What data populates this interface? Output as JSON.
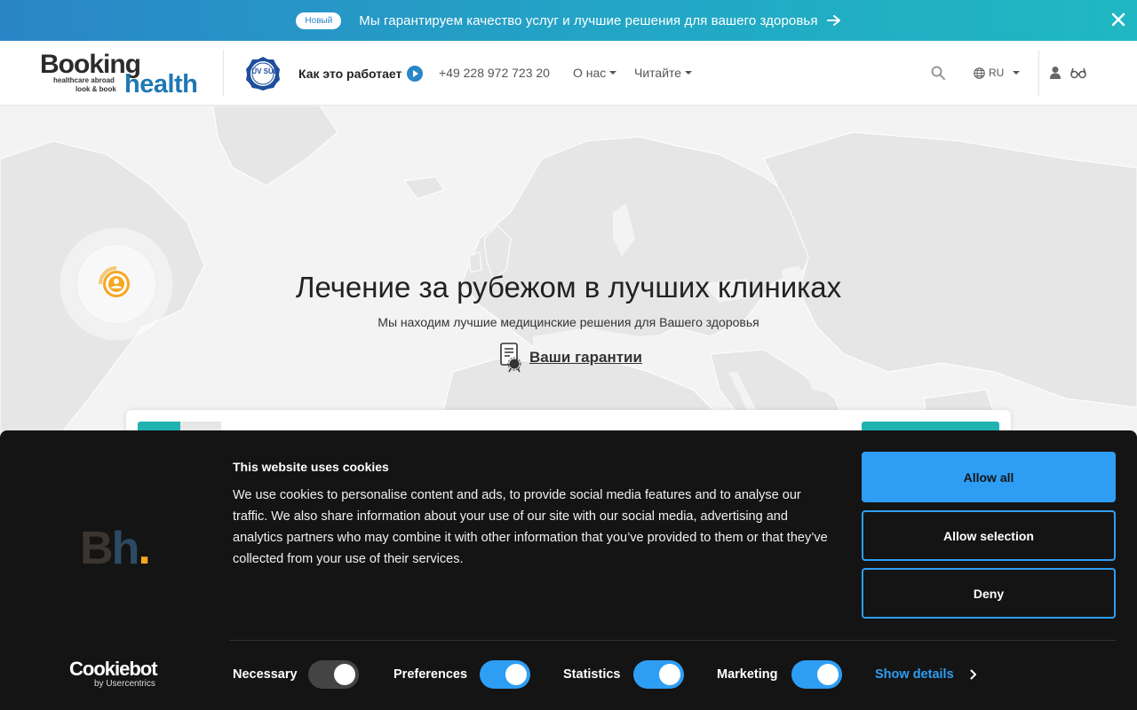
{
  "promo": {
    "badge": "Новый",
    "text": "Мы гарантируем качество услуг и лучшие решения для вашего здоровья"
  },
  "logo": {
    "word1": "Booking",
    "word2": "health",
    "tagline1": "healthcare abroad",
    "tagline2": "look & book"
  },
  "header": {
    "tuv_label": "TÜV SÜD",
    "nav_how": "Как это работает",
    "phone": "+49 228 972 723 20",
    "about": "О нас",
    "read": "Читайте",
    "language": "RU"
  },
  "hero": {
    "title": "Лечение за рубежом в лучших клиниках",
    "subtitle": "Мы находим лучшие медицинские решения для Вашего здоровья",
    "guarantee_link": "Ваши гарантии"
  },
  "cookie": {
    "logo_b": "B",
    "logo_h": "h",
    "logo_dot": ".",
    "title": "This website uses cookies",
    "body": "We use cookies to personalise content and ads, to provide social media features and to analyse our traffic. We also share information about your use of our site with our social media, advertising and analytics partners who may combine it with other information that you’ve provided to them or that they’ve collected from your use of their services.",
    "allow_all": "Allow all",
    "allow_selection": "Allow selection",
    "deny": "Deny",
    "brand_main": "Cookiebot",
    "brand_sub": "by Usercentrics",
    "toggles": [
      {
        "label": "Necessary",
        "on": false
      },
      {
        "label": "Preferences",
        "on": true
      },
      {
        "label": "Statistics",
        "on": true
      },
      {
        "label": "Marketing",
        "on": true
      }
    ],
    "show_details": "Show details"
  },
  "colors": {
    "accent": "#2e9ef4",
    "teal": "#20b3b0",
    "brand_blue": "#1f78b4",
    "orange": "#f5a623"
  }
}
